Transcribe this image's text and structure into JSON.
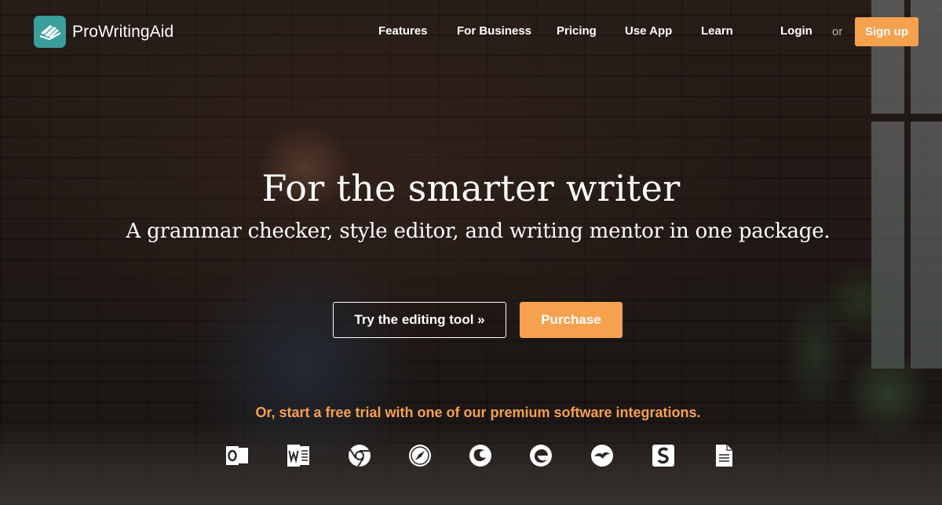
{
  "brand": {
    "name": "ProWritingAid",
    "logo_icon": "feather-book-icon",
    "accent": "#3a9e9a"
  },
  "nav": {
    "items": [
      {
        "label": "Features",
        "key": "features"
      },
      {
        "label": "For Business",
        "key": "for-business"
      },
      {
        "label": "Pricing",
        "key": "pricing"
      },
      {
        "label": "Use App",
        "key": "use-app"
      },
      {
        "label": "Learn",
        "key": "learn"
      }
    ],
    "login": "Login",
    "or": "or",
    "signup": "Sign up"
  },
  "hero": {
    "title": "For the smarter writer",
    "subtitle": "A grammar checker, style editor, and writing mentor in one package.",
    "try_button": "Try the editing tool »",
    "purchase_button": "Purchase",
    "trial_text": "Or, start a free trial with one of our premium software integrations."
  },
  "integrations": [
    {
      "name": "outlook-icon"
    },
    {
      "name": "word-icon"
    },
    {
      "name": "chrome-icon"
    },
    {
      "name": "safari-icon"
    },
    {
      "name": "firefox-icon"
    },
    {
      "name": "edge-icon"
    },
    {
      "name": "openoffice-icon"
    },
    {
      "name": "scrivener-icon"
    },
    {
      "name": "document-icon"
    }
  ],
  "colors": {
    "orange": "#f6a14d",
    "teal": "#3a9e9a",
    "text": "#ffffff",
    "muted": "#b5b0ad"
  }
}
